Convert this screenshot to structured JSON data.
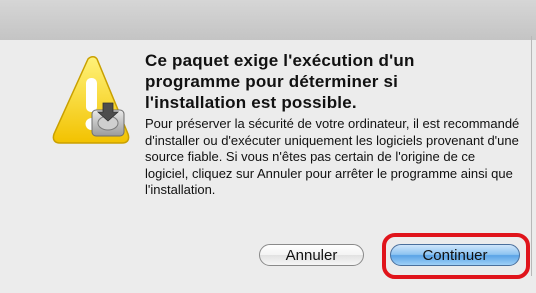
{
  "dialog": {
    "heading": "Ce paquet exige l'exécution d'un programme pour déterminer si l'installation est possible.",
    "body": "Pour préserver la sécurité de votre ordinateur, il est recommandé d'installer ou d'exécuter uniquement les logiciels provenant d'une source fiable. Si vous n'êtes pas certain de l'origine de ce logiciel, cliquez sur Annuler pour arrêter le programme ainsi que l'installation.",
    "icon": "caution-installer-icon"
  },
  "buttons": {
    "cancel_label": "Annuler",
    "continue_label": "Continuer"
  },
  "colors": {
    "highlight": "#e0141b",
    "default_button": "#5aa3e6"
  }
}
